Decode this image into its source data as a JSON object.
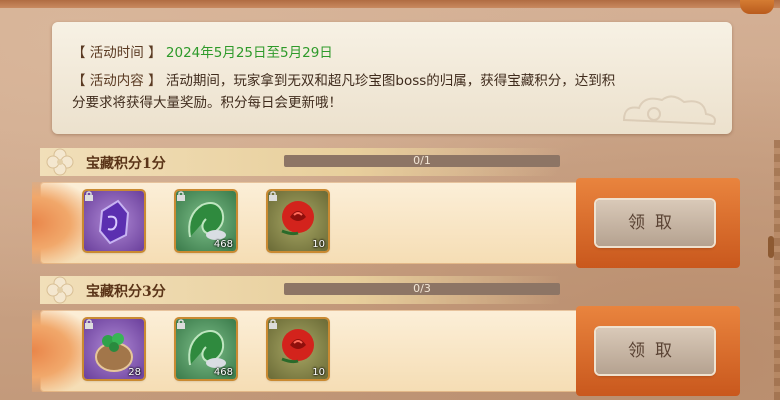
{
  "info": {
    "time_label": "【 活动时间 】",
    "time_value": "2024年5月25日至5月29日",
    "content_label": "【 活动内容 】",
    "content_line1": "活动期间，玩家拿到无双和超凡珍宝图boss的归属，获得宝藏积分，达到积",
    "content_line2": "分要求将获得大量奖励。积分每日会更新哦！"
  },
  "tiers": [
    {
      "title": "宝藏积分1分",
      "progress_text": "0/1",
      "progress_fraction": 0,
      "claim_label": "领取",
      "items": [
        {
          "icon": "purple-crystal-icon",
          "count": ""
        },
        {
          "icon": "green-dragon-icon",
          "count": "468"
        },
        {
          "icon": "red-rose-icon",
          "count": "10"
        }
      ]
    },
    {
      "title": "宝藏积分3分",
      "progress_text": "0/3",
      "progress_fraction": 0,
      "claim_label": "领取",
      "items": [
        {
          "icon": "treasure-bag-icon",
          "count": "28"
        },
        {
          "icon": "green-dragon-icon",
          "count": "468"
        },
        {
          "icon": "red-rose-icon",
          "count": "10"
        }
      ]
    }
  ],
  "colors": {
    "date": "#2e9a2a",
    "claim_band": "#e9843e",
    "progress_track": "#8d7565"
  }
}
